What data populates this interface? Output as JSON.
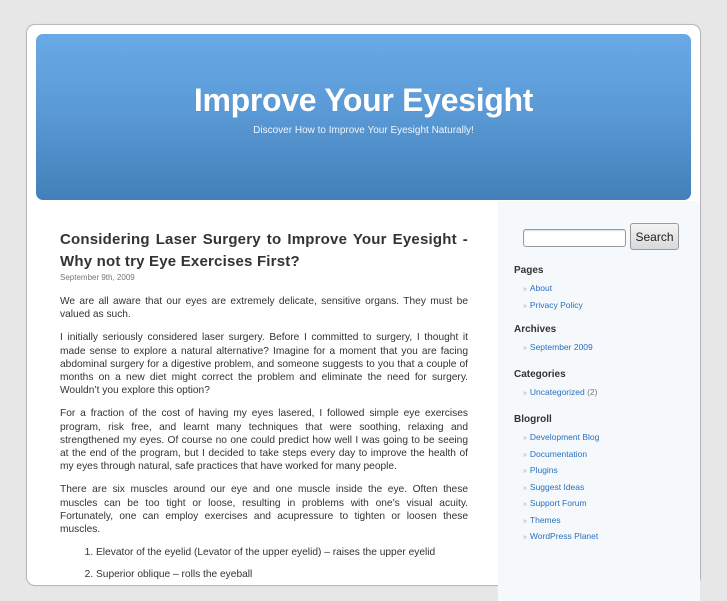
{
  "header": {
    "title": "Improve Your Eyesight",
    "description": "Discover How to Improve Your Eyesight Naturally!"
  },
  "post": {
    "title": "Considering Laser Surgery to Improve Your Eyesight - Why not try Eye Exercises First?",
    "date": "September 9th, 2009",
    "paragraphs": [
      "We are all aware that our eyes are extremely delicate, sensitive organs. They must be valued as such.",
      "I initially seriously considered laser surgery.  Before I committed to surgery, I thought it made sense to explore a natural alternative? Imagine for a moment that you are facing abdominal surgery for a digestive problem, and someone suggests to you that a couple of months on a new diet might correct the problem and eliminate the need for surgery. Wouldn’t you explore this option?",
      "For a fraction of the cost of having my eyes lasered, I followed simple eye exercises program, risk free, and learnt many techniques that were soothing, relaxing and strengthened my eyes. Of course no one could predict how well I was going to be seeing at the end of the program, but I decided to take steps every day to improve the health of my eyes through natural, safe practices that have worked for many people.",
      "There are six muscles around our eye and one muscle inside the eye. Often these muscles can be too tight or loose, resulting in problems with one’s visual acuity. Fortunately, one can employ exercises and acupressure to tighten or loosen these muscles."
    ],
    "list": [
      "Elevator of the eyelid (Levator of the upper eyelid) – raises the upper eyelid",
      "Superior oblique – rolls the eyeball"
    ]
  },
  "sidebar": {
    "search": {
      "value": "",
      "placeholder": "",
      "button_label": "Search"
    },
    "pages": {
      "heading": "Pages",
      "items": [
        "About",
        "Privacy Policy"
      ]
    },
    "archives": {
      "heading": "Archives",
      "items": [
        "September 2009"
      ]
    },
    "categories": {
      "heading": "Categories",
      "items": [
        {
          "label": "Uncategorized",
          "count": "(2)"
        }
      ]
    },
    "blogroll": {
      "heading": "Blogroll",
      "items": [
        "Development Blog",
        "Documentation",
        "Plugins",
        "Suggest Ideas",
        "Support Forum",
        "Themes",
        "WordPress Planet"
      ]
    },
    "bullet": "»"
  },
  "colors": {
    "header_top": "#69aae6",
    "header_bottom": "#4380b9",
    "link": "#2a6fc1",
    "sidebar_bg": "#f5f9fc",
    "page_bg": "#e7e7e7"
  }
}
